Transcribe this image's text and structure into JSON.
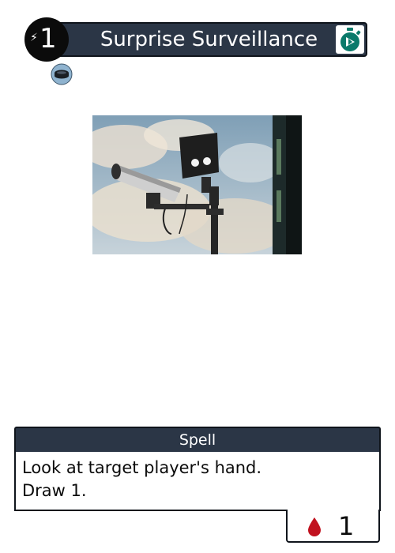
{
  "card": {
    "title": "Surprise Surveillance",
    "cost": "1",
    "type": "Spell",
    "rules": [
      "Look at target player's hand.",
      "Draw 1."
    ],
    "blood_cost": "1"
  },
  "icons": {
    "cost": "lightning-bolt-icon",
    "speed": "stopwatch-icon",
    "set": "disc-icon",
    "blood": "blood-drop-icon"
  },
  "colors": {
    "bar": "#2b3646",
    "speed_icon": "#0b7a6b",
    "blood": "#c1121f"
  }
}
